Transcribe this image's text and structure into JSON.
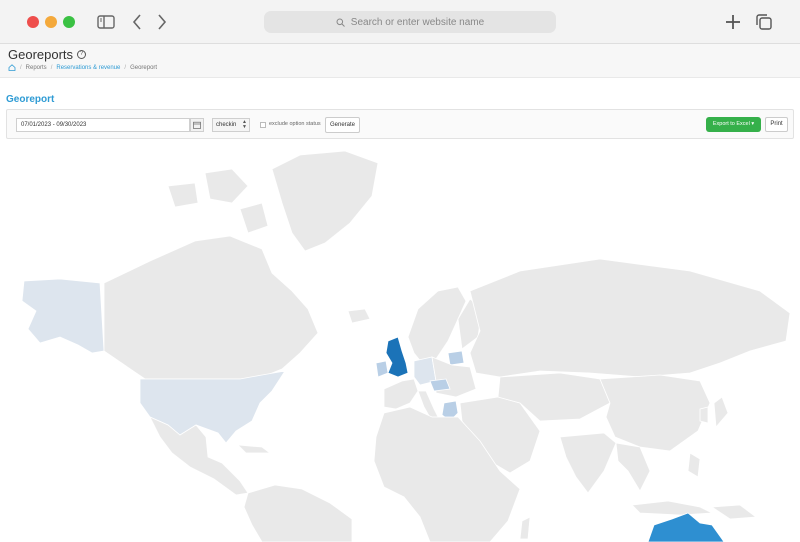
{
  "browser": {
    "address_placeholder": "Search or enter website name",
    "icons": {
      "sidebar": "sidebar-icon",
      "back": "chevron-left-icon",
      "forward": "chevron-right-icon",
      "new_tab": "plus-icon",
      "tabs": "tabs-icon"
    }
  },
  "header": {
    "title": "Georeports",
    "breadcrumb": [
      "Reports",
      "Reservations & revenue",
      "Georeport"
    ]
  },
  "section": {
    "title": "Georeport"
  },
  "toolbar": {
    "date_range": "07/01/2023 - 09/30/2023",
    "date_type": "checkin",
    "exclude_label": "exclude option status",
    "exclude_checked": false,
    "generate_label": "Generate",
    "export_label": "Export to Excel",
    "print_label": "Print"
  },
  "map": {
    "base_color": "#e9e9e9",
    "border_color": "#ffffff",
    "scale_colors": [
      "#dde5ee",
      "#b9cfe6",
      "#2e8fd1",
      "#1b73b8"
    ],
    "highlighted": [
      {
        "region": "United Kingdom",
        "level": 4
      },
      {
        "region": "Ireland",
        "level": 2
      },
      {
        "region": "Australia",
        "level": 3
      },
      {
        "region": "Greece",
        "level": 2
      },
      {
        "region": "Germany",
        "level": 1
      },
      {
        "region": "United States",
        "level": 1
      },
      {
        "region": "Alaska",
        "level": 1
      },
      {
        "region": "Latvia",
        "level": 1
      },
      {
        "region": "Hungary",
        "level": 1
      }
    ]
  }
}
